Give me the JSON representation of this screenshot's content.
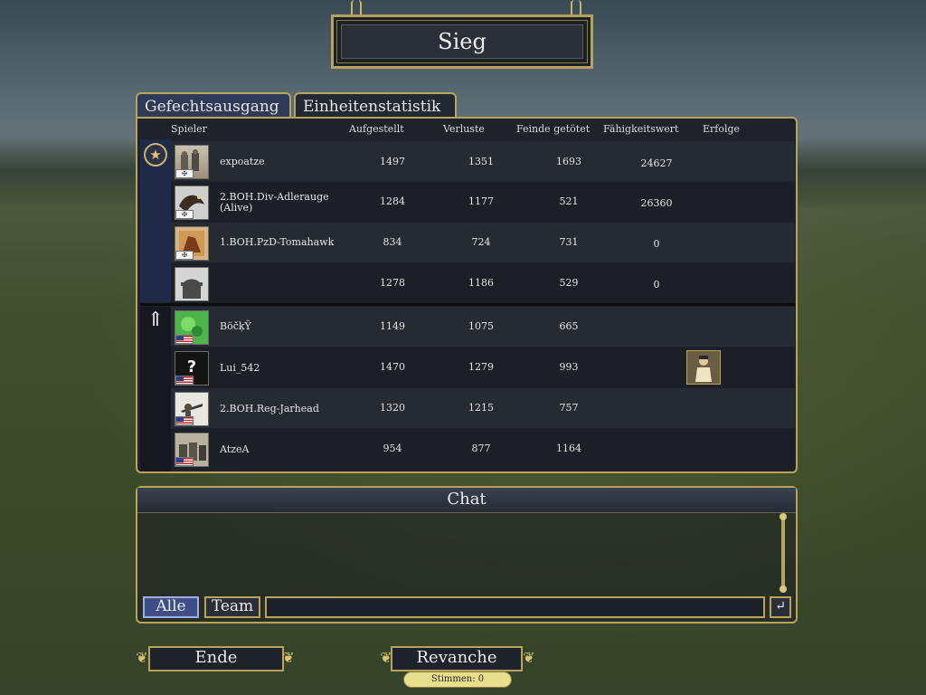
{
  "title": "Sieg",
  "tabs": [
    "Gefechtsausgang",
    "Einheitenstatistik"
  ],
  "columns": [
    "Spieler",
    "Aufgestellt",
    "Verluste",
    "Feinde getötet",
    "Fähigkeitswert",
    "Erfolge"
  ],
  "team1": [
    {
      "name": "expoatze",
      "deployed": "1497",
      "losses": "1351",
      "kills": "1693",
      "skill": "24627"
    },
    {
      "name": "2.BOH.Div-Adlerauge (Alive)",
      "deployed": "1284",
      "losses": "1177",
      "kills": "521",
      "skill": "26360"
    },
    {
      "name": "1.BOH.PzD-Tomahawk",
      "deployed": "834",
      "losses": "724",
      "kills": "731",
      "skill": "0"
    },
    {
      "name": "",
      "deployed": "1278",
      "losses": "1186",
      "kills": "529",
      "skill": "0"
    }
  ],
  "team2": [
    {
      "name": "BöčķŶ",
      "deployed": "1149",
      "losses": "1075",
      "kills": "665",
      "skill": ""
    },
    {
      "name": "Lui_542",
      "deployed": "1470",
      "losses": "1279",
      "kills": "993",
      "skill": ""
    },
    {
      "name": "2.BOH.Reg-Jarhead",
      "deployed": "1320",
      "losses": "1215",
      "kills": "757",
      "skill": ""
    },
    {
      "name": "AtzeA",
      "deployed": "954",
      "losses": "877",
      "kills": "1164",
      "skill": ""
    }
  ],
  "chat": {
    "title": "Chat",
    "all_label": "Alle",
    "team_label": "Team",
    "input_value": "",
    "send_icon": "↵"
  },
  "buttons": {
    "end": "Ende",
    "rematch": "Revanche"
  },
  "votes": "Stimmen: 0",
  "colors": {
    "accent_gold": "#b8a35c",
    "active_tab": "#2e3a58",
    "active_chat": "#3f4e86"
  }
}
